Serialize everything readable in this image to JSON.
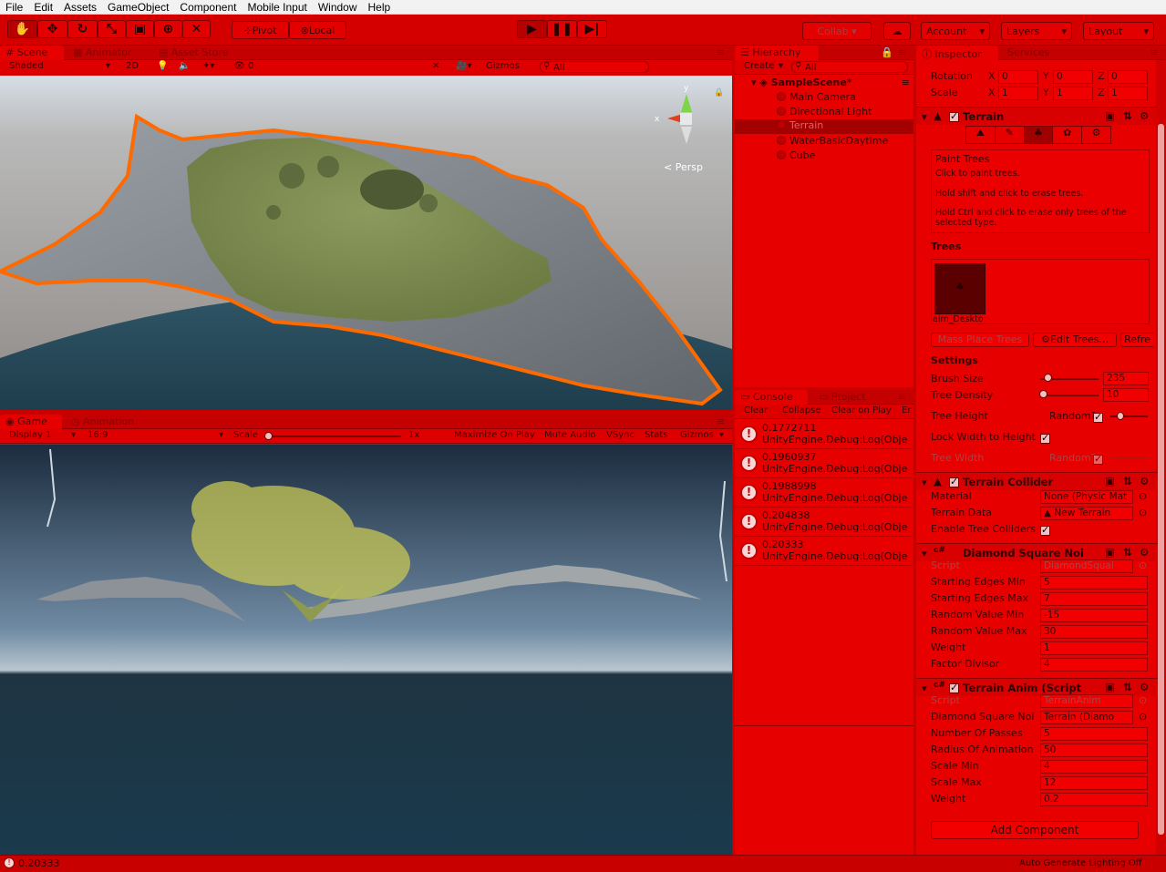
{
  "menu": [
    "File",
    "Edit",
    "Assets",
    "GameObject",
    "Component",
    "Mobile Input",
    "Window",
    "Help"
  ],
  "toolbar": {
    "pivot": "Pivot",
    "local": "Local",
    "collab": "Collab",
    "account": "Account",
    "layers": "Layers",
    "layout": "Layout"
  },
  "scene": {
    "tabs": [
      "Scene",
      "Animator",
      "Asset Store"
    ],
    "shading": "Shaded",
    "mode2d": "2D",
    "layer_count": "0",
    "gizmos": "Gizmos",
    "search_placeholder": "All",
    "persp": "Persp"
  },
  "game": {
    "tabs": [
      "Game",
      "Animation"
    ],
    "display": "Display 1",
    "aspect": "16:9",
    "scale_label": "Scale",
    "scale_value": "1x",
    "maximize": "Maximize On Play",
    "mute": "Mute Audio",
    "vsync": "VSync",
    "stats": "Stats",
    "gizmos": "Gizmos"
  },
  "hierarchy": {
    "tab": "Hierarchy",
    "create": "Create",
    "search_placeholder": "All",
    "scene": "SampleScene*",
    "items": [
      "Main Camera",
      "Directional Light",
      "Terrain",
      "WaterBasicDaytime",
      "Cube"
    ]
  },
  "console": {
    "tabs": [
      "Console",
      "Project"
    ],
    "clear": "Clear",
    "collapse": "Collapse",
    "clear_on_play": "Clear on Play",
    "er": "Er",
    "entries": [
      {
        "value": "0.1772711",
        "msg": "UnityEngine.Debug:Log(Obje"
      },
      {
        "value": "0.1960937",
        "msg": "UnityEngine.Debug:Log(Obje"
      },
      {
        "value": "0.1988998",
        "msg": "UnityEngine.Debug:Log(Obje"
      },
      {
        "value": "0.204838",
        "msg": "UnityEngine.Debug:Log(Obje"
      },
      {
        "value": "0.20333",
        "msg": "UnityEngine.Debug:Log(Obje"
      }
    ]
  },
  "inspector": {
    "tabs": [
      "Inspector",
      "Services"
    ],
    "transform": {
      "rotation_label": "Rotation",
      "scale_label": "Scale",
      "rotation": {
        "x": "0",
        "y": "0",
        "z": "0"
      },
      "scale": {
        "x": "1",
        "y": "1",
        "z": "1"
      }
    },
    "terrain": {
      "title": "Terrain",
      "paint_trees": "Paint Trees",
      "help1": "Click to paint trees.",
      "help2": "Hold shift and click to erase trees.",
      "help3": "Hold Ctrl and click to erase only trees of the selected type.",
      "trees_label": "Trees",
      "tree_name": "aim_Deskto",
      "mass_place": "Mass Place Trees",
      "edit_trees": "Edit Trees...",
      "refresh": "Refre",
      "settings_label": "Settings",
      "brush_size_label": "Brush Size",
      "brush_size": "235",
      "tree_density_label": "Tree Density",
      "tree_density": "10",
      "tree_height_label": "Tree Height",
      "random_label": "Random?",
      "lock_width": "Lock Width to Height",
      "tree_width_label": "Tree Width",
      "brush_size_fraction": 0.12,
      "tree_density_fraction": 0.05
    },
    "collider": {
      "title": "Terrain Collider",
      "material_label": "Material",
      "material": "None (Physic Mat",
      "data_label": "Terrain Data",
      "data": "New Terrain",
      "enable_label": "Enable Tree Colliders"
    },
    "diamond": {
      "title": "Diamond Square Noi",
      "script_label": "Script",
      "script": "DiamondSquai",
      "rows": [
        {
          "label": "Starting Edges Min",
          "value": "5"
        },
        {
          "label": "Starting Edges Max",
          "value": "7"
        },
        {
          "label": "Random Value Min",
          "value": "-15"
        },
        {
          "label": "Random Value Max",
          "value": "30"
        },
        {
          "label": "Weight",
          "value": "1"
        },
        {
          "label": "Factor Divisor",
          "value": "4"
        }
      ]
    },
    "anim": {
      "title": "Terrain Anim (Script",
      "script_label": "Script",
      "script": "TerrainAnim",
      "noise_label": "Diamond Square Noi",
      "noise": "Terrain (Diamo",
      "rows": [
        {
          "label": "Number Of Passes",
          "value": "5"
        },
        {
          "label": "Radius Of Animation",
          "value": "50"
        },
        {
          "label": "Scale Min",
          "value": "4"
        },
        {
          "label": "Scale Max",
          "value": "12"
        },
        {
          "label": "Weight",
          "value": "0.2"
        }
      ]
    },
    "add_component": "Add Component"
  },
  "status": {
    "last_log": "0.20333",
    "lighting": "Auto Generate Lighting Off"
  },
  "colors": {
    "tint": "#e60000",
    "dark": "#8a0000"
  }
}
